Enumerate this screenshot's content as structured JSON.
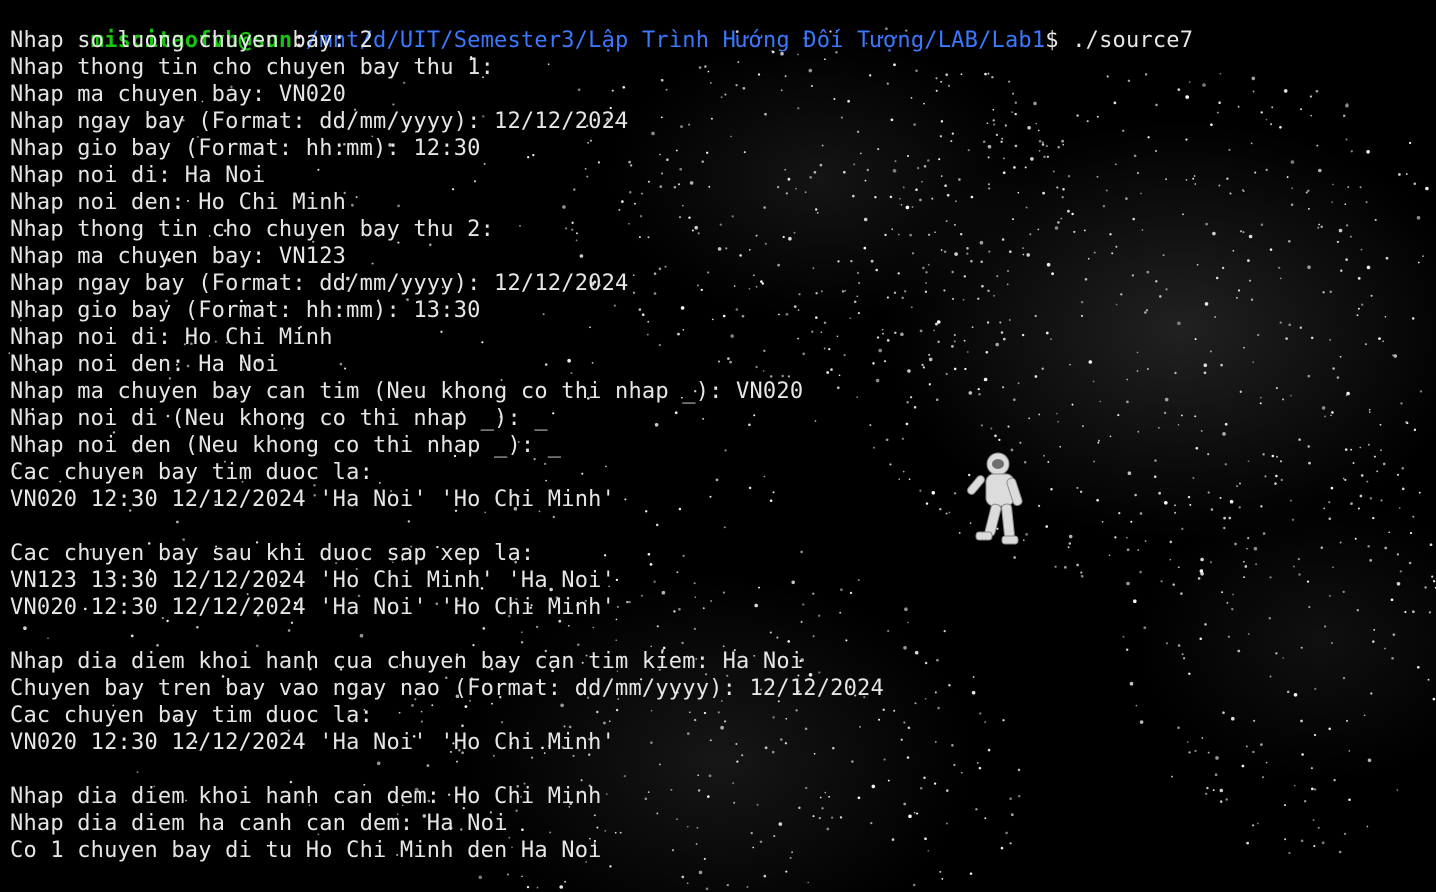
{
  "prompt": {
    "user": "miscitaofvh@sun",
    "separator": ":",
    "path": "/mnt/d/UIT/Semester3/Lập Trình Hướng Đối Tượng/LAB/Lab1",
    "symbol": "$"
  },
  "command": " ./source7",
  "output": [
    "Nhap so luong chuyen bay: 2",
    "Nhap thong tin cho chuyen bay thu 1:",
    "Nhap ma chuyen bay: VN020",
    "Nhap ngay bay (Format: dd/mm/yyyy): 12/12/2024",
    "Nhap gio bay (Format: hh:mm): 12:30",
    "Nhap noi di: Ha Noi",
    "Nhap noi den: Ho Chi Minh",
    "Nhap thong tin cho chuyen bay thu 2:",
    "Nhap ma chuyen bay: VN123",
    "Nhap ngay bay (Format: dd/mm/yyyy): 12/12/2024",
    "Nhap gio bay (Format: hh:mm): 13:30",
    "Nhap noi di: Ho Chi Minh",
    "Nhap noi den: Ha Noi",
    "Nhap ma chuyen bay can tim (Neu khong co thi nhap _): VN020",
    "Nhap noi di (Neu khong co thi nhap _): _",
    "Nhap noi den (Neu khong co thi nhap _): _",
    "Cac chuyen bay tim duoc la:",
    "VN020 12:30 12/12/2024 'Ha Noi' 'Ho Chi Minh'",
    "",
    "Cac chuyen bay sau khi duoc sap xep la:",
    "VN123 13:30 12/12/2024 'Ho Chi Minh' 'Ha Noi'",
    "VN020 12:30 12/12/2024 'Ha Noi' 'Ho Chi Minh'",
    "",
    "Nhap dia diem khoi hanh cua chuyen bay can tim kiem: Ha Noi",
    "Chuyen bay tren bay vao ngay nao (Format: dd/mm/yyyy): 12/12/2024",
    "Cac chuyen bay tim duoc la:",
    "VN020 12:30 12/12/2024 'Ha Noi' 'Ho Chi Minh'",
    "",
    "Nhap dia diem khoi hanh can dem: Ho Chi Minh",
    "Nhap dia diem ha canh can dem: Ha Noi",
    "Co 1 chuyen bay di tu Ho Chi Minh den Ha Noi"
  ],
  "colors": {
    "user": "#16c60c",
    "path": "#3b78ff",
    "text": "#e6e6e6",
    "background": "#000000"
  }
}
